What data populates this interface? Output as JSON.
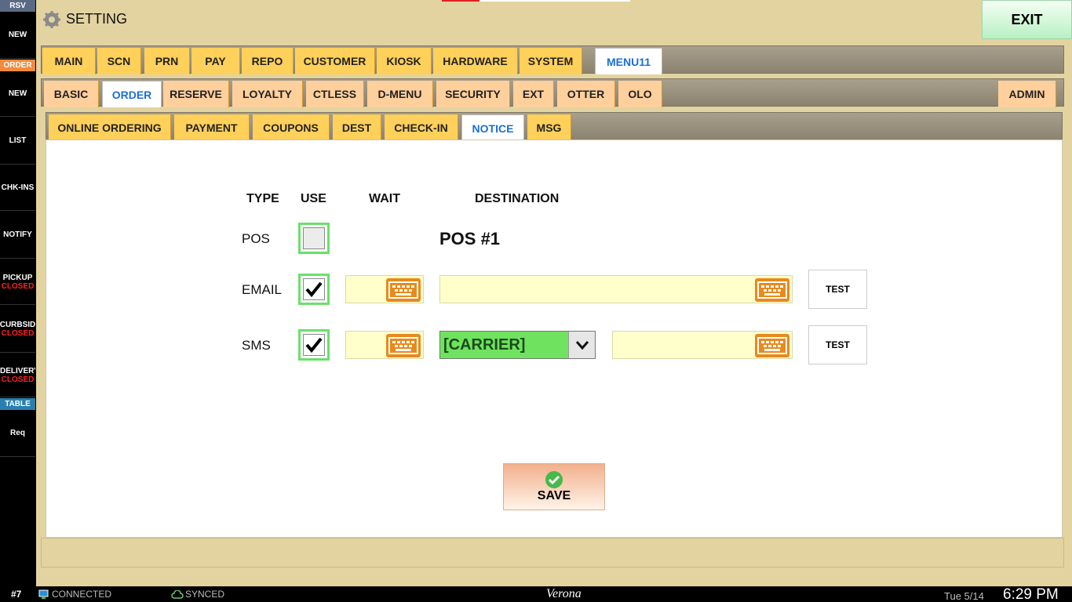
{
  "sidebar": {
    "rsv": "RSV",
    "order": "ORDER",
    "table": "TABLE",
    "items": [
      {
        "label": "NEW"
      },
      {
        "label": "NEW"
      },
      {
        "label": "LIST"
      },
      {
        "label": "CHK-INS"
      },
      {
        "label": "NOTIFY"
      },
      {
        "label": "PICKUP",
        "status": "CLOSED"
      },
      {
        "label": "CURBSID",
        "status": "CLOSED"
      },
      {
        "label": "DELIVERY",
        "status": "CLOSED"
      },
      {
        "label": "Req"
      }
    ]
  },
  "header": {
    "title": "SETTING",
    "exit_label": "EXIT",
    "progress_fraction": 0.2
  },
  "tabs_top": [
    "MAIN",
    "SCN",
    "PRN",
    "PAY",
    "REPO",
    "CUSTOMER",
    "KIOSK",
    "HARDWARE",
    "SYSTEM",
    "MENU11"
  ],
  "tabs_mid": [
    "BASIC",
    "ORDER",
    "RESERVE",
    "LOYALTY",
    "CTLESS",
    "D-MENU",
    "SECURITY",
    "EXT",
    "OTTER",
    "OLO",
    "ADMIN"
  ],
  "tabs_sub": [
    "ONLINE ORDERING",
    "PAYMENT",
    "COUPONS",
    "DEST",
    "CHECK-IN",
    "NOTICE",
    "MSG"
  ],
  "active": {
    "top": "MENU11",
    "mid": "ORDER",
    "sub": "NOTICE"
  },
  "notice": {
    "headers": {
      "type": "TYPE",
      "use": "USE",
      "wait": "WAIT",
      "destination": "DESTINATION"
    },
    "rows": {
      "pos": {
        "type": "POS",
        "use": false,
        "destination": "POS #1"
      },
      "email": {
        "type": "EMAIL",
        "use": true,
        "wait": "",
        "destination": "",
        "test_label": "TEST"
      },
      "sms": {
        "type": "SMS",
        "use": true,
        "wait": "",
        "carrier": "[CARRIER]",
        "destination": "",
        "test_label": "TEST"
      }
    },
    "save_label": "SAVE"
  },
  "statusbar": {
    "station": "#7",
    "connection": "CONNECTED",
    "sync": "SYNCED",
    "store": "Verona",
    "date": "Tue 5/14",
    "time": "6:29 PM"
  },
  "colors": {
    "accent_tab": "#ffd05a",
    "active_text": "#1b6fd6",
    "check_border": "#6ae06a",
    "field_bg": "#ffffcc",
    "keyboard": "#e88a1c",
    "closed": "#ff2020"
  }
}
